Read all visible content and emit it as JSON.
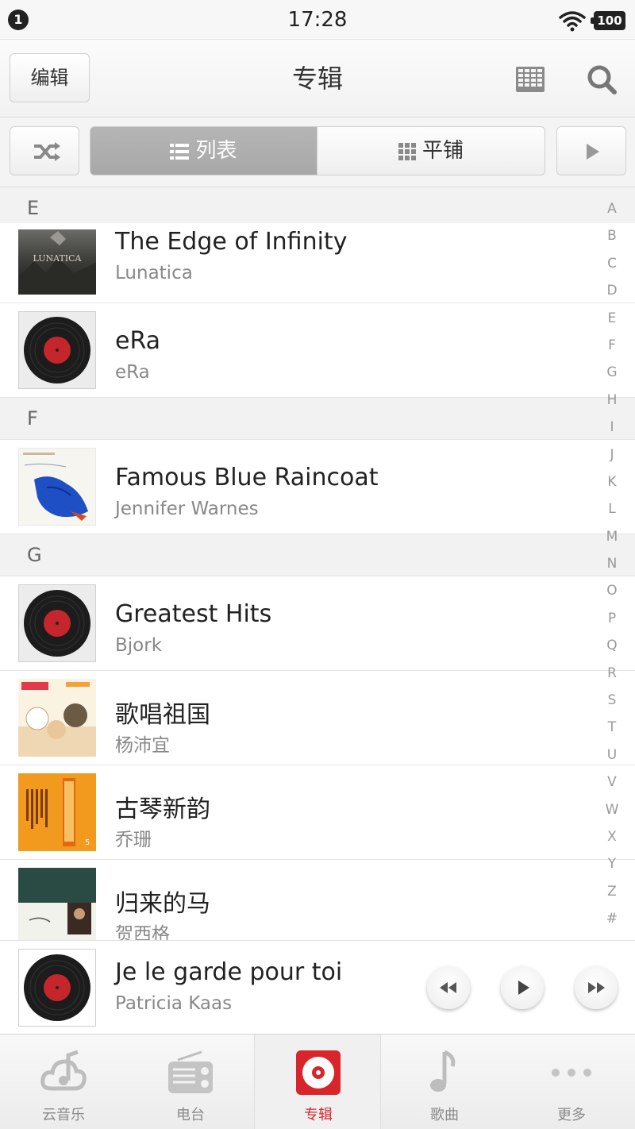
{
  "status_bar": {
    "notification_count": "1",
    "time": "17:28",
    "battery": "100"
  },
  "header": {
    "edit_label": "编辑",
    "title": "专辑"
  },
  "segment": {
    "list_label": "列表",
    "tile_label": "平铺"
  },
  "sections": [
    {
      "letter": "E",
      "albums": [
        {
          "title": "The Edge of Infinity",
          "artist": "Lunatica",
          "cover": "lunatica-cover"
        },
        {
          "title": "eRa",
          "artist": "eRa",
          "cover": "vinyl-placeholder"
        }
      ]
    },
    {
      "letter": "F",
      "albums": [
        {
          "title": "Famous Blue Raincoat",
          "artist": "Jennifer Warnes",
          "cover": "blue-raincoat-cover"
        }
      ]
    },
    {
      "letter": "G",
      "albums": [
        {
          "title": "Greatest Hits",
          "artist": "Bjork",
          "cover": "vinyl-placeholder"
        },
        {
          "title": "歌唱祖国",
          "artist": "杨沛宜",
          "cover": "cartoon-cover"
        },
        {
          "title": "古琴新韵",
          "artist": "乔珊",
          "cover": "orange-cover"
        },
        {
          "title": "归来的马",
          "artist": "贺西格",
          "cover": "dark-green-cover"
        }
      ]
    }
  ],
  "alphabet_index": [
    "A",
    "B",
    "C",
    "D",
    "E",
    "F",
    "G",
    "H",
    "I",
    "J",
    "K",
    "L",
    "M",
    "N",
    "O",
    "P",
    "Q",
    "R",
    "S",
    "T",
    "U",
    "V",
    "W",
    "X",
    "Y",
    "Z",
    "#"
  ],
  "now_playing": {
    "title": "Je le garde pour toi",
    "artist": "Patricia Kaas",
    "cover": "vinyl-placeholder"
  },
  "tabs": [
    {
      "label": "云音乐",
      "icon": "cloud-music-icon",
      "active": false
    },
    {
      "label": "电台",
      "icon": "radio-icon",
      "active": false
    },
    {
      "label": "专辑",
      "icon": "album-disc-icon",
      "active": true
    },
    {
      "label": "歌曲",
      "icon": "music-note-icon",
      "active": false
    },
    {
      "label": "更多",
      "icon": "more-dots-icon",
      "active": false
    }
  ],
  "colors": {
    "accent": "#d8252b",
    "section_bg": "#f2f2f2",
    "active_segment": "#aaaaaa"
  }
}
